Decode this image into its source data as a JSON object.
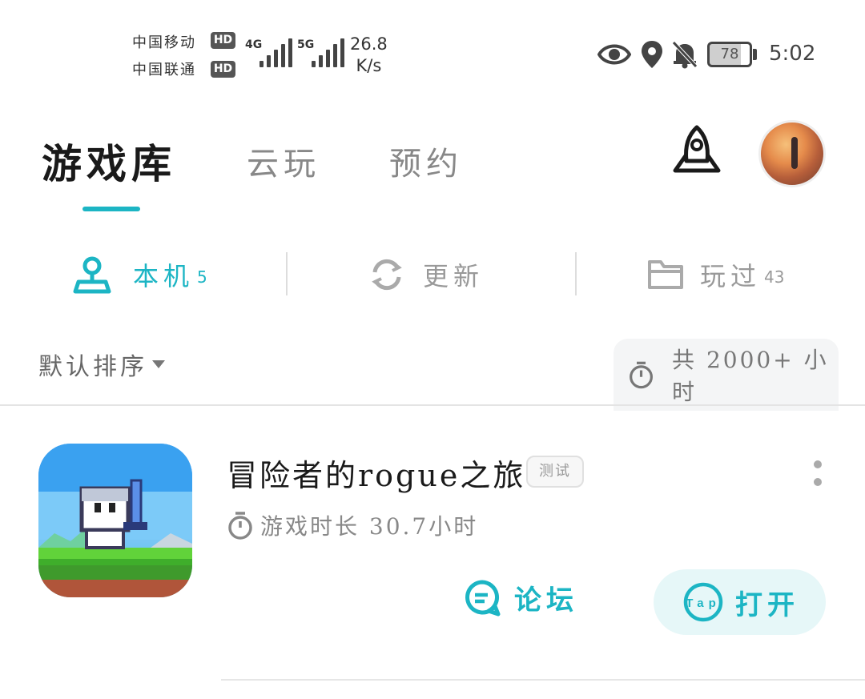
{
  "status_bar": {
    "carrier1": "中国移动",
    "carrier2": "中国联通",
    "hd_badge": "HD",
    "net1": "4G",
    "net2": "5G",
    "speed_value": "26.8",
    "speed_unit": "K/s",
    "battery_level": "78",
    "time": "5:02",
    "icons": [
      "eye-icon",
      "location-icon",
      "bell-off-icon",
      "battery-icon"
    ]
  },
  "header": {
    "tabs": [
      {
        "label": "游戏库",
        "active": true
      },
      {
        "label": "云玩",
        "active": false
      },
      {
        "label": "预约",
        "active": false
      }
    ],
    "accent": "#1cb5c4"
  },
  "subtabs": [
    {
      "label": "本机",
      "count": "5",
      "active": true
    },
    {
      "label": "更新",
      "count": "",
      "active": false
    },
    {
      "label": "玩过",
      "count": "43",
      "active": false
    }
  ],
  "sort": {
    "label": "默认排序",
    "total_playtime": "共 2000+ 小时"
  },
  "games": [
    {
      "title": "冒险者的rogue之旅",
      "badge": "测试",
      "playtime": "游戏时长 30.7小时",
      "forum_label": "论坛",
      "open_label": "打开"
    }
  ]
}
